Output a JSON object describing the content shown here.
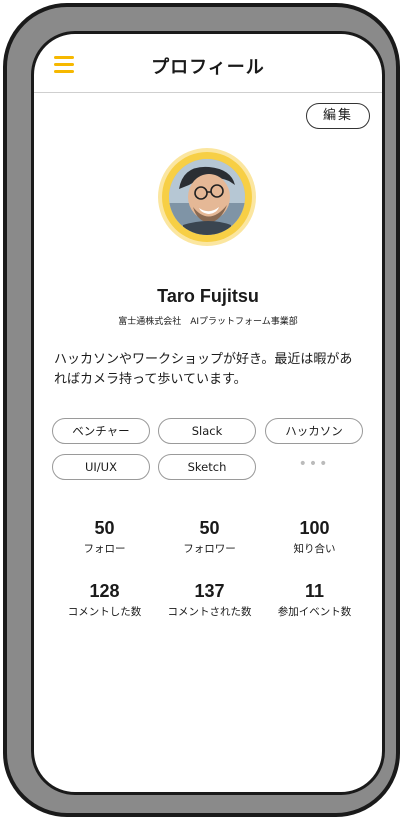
{
  "header": {
    "title": "プロフィール",
    "menu_icon": "hamburger-icon",
    "accent": "#f6b800"
  },
  "edit_button": {
    "label": "編集"
  },
  "profile": {
    "name": "Taro Fujitsu",
    "affiliation": "富士通株式会社　AIプラットフォーム事業部",
    "bio": "ハッカソンやワークショップが好き。最近は暇があればカメラ持って歩いています。"
  },
  "tags": [
    "ベンチャー",
    "Slack",
    "ハッカソン",
    "UI/UX",
    "Sketch"
  ],
  "tags_more": "•••",
  "stats": [
    {
      "value": "50",
      "label": "フォロー"
    },
    {
      "value": "50",
      "label": "フォロワー"
    },
    {
      "value": "100",
      "label": "知り合い"
    },
    {
      "value": "128",
      "label": "コメントした数"
    },
    {
      "value": "137",
      "label": "コメントされた数"
    },
    {
      "value": "11",
      "label": "参加イベント数"
    }
  ]
}
